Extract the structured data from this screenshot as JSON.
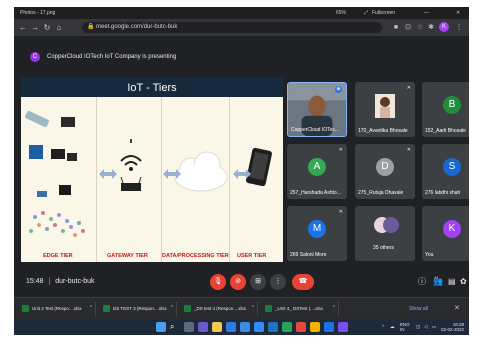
{
  "photos_viewer": {
    "title": "Photos - 17.png",
    "zoom": "65%",
    "fullscreen_label": "Fullscreen"
  },
  "browser": {
    "url": "meet.google.com/dur-butc-buk",
    "profile_initial": "K"
  },
  "presenting": {
    "avatar_initial": "C",
    "text": "CopperCloud IOTech IoT Company is presenting"
  },
  "slide": {
    "title": "IoT - Tiers",
    "tiers": [
      "EDGE TIER",
      "GATEWAY TIER",
      "DATA/PROCESSING TIER",
      "USER TIER"
    ]
  },
  "participants": [
    {
      "name": "CopperCloud IOTec...",
      "initial": "",
      "color": "#5f6d7a"
    },
    {
      "name": "170_Avantika Bhosale",
      "initial": "",
      "color": "#3c4043"
    },
    {
      "name": "152_Aarti Bhosale",
      "initial": "B",
      "color": "#1e8e3e"
    },
    {
      "name": "257_Harshada Ashto...",
      "initial": "A",
      "color": "#34a853"
    },
    {
      "name": "275_Rutuja Dhavale",
      "initial": "D",
      "color": "#9aa0a6"
    },
    {
      "name": "276 labdhi shah",
      "initial": "S",
      "color": "#1967d2"
    },
    {
      "name": "269 Saloni More",
      "initial": "M",
      "color": "#1a73e8"
    },
    {
      "name": "35 others",
      "initial": "",
      "color": "#3c4043"
    },
    {
      "name": "You",
      "initial": "K",
      "color": "#a142f4"
    }
  ],
  "meeting": {
    "time": "15:48",
    "code": "dur-butc-buk",
    "participant_count": "44"
  },
  "downloads": [
    "Unit 2 Test (Respo....xlsx",
    "DS TEST 3 (Respon....xlsx",
    "_DS test 4 (Respon....xlsx",
    "_Unit 4_ DSTest (....xlsx"
  ],
  "downloads_show_all": "Show all",
  "taskbar": {
    "lang_top": "ENG",
    "lang_bottom": "IN",
    "time": "16:28",
    "date": "02-02-2022"
  },
  "colors": {
    "meet_bg": "#202124",
    "end_call": "#ea4335",
    "slide_header": "#17293d",
    "tier_label": "#c4161c"
  }
}
